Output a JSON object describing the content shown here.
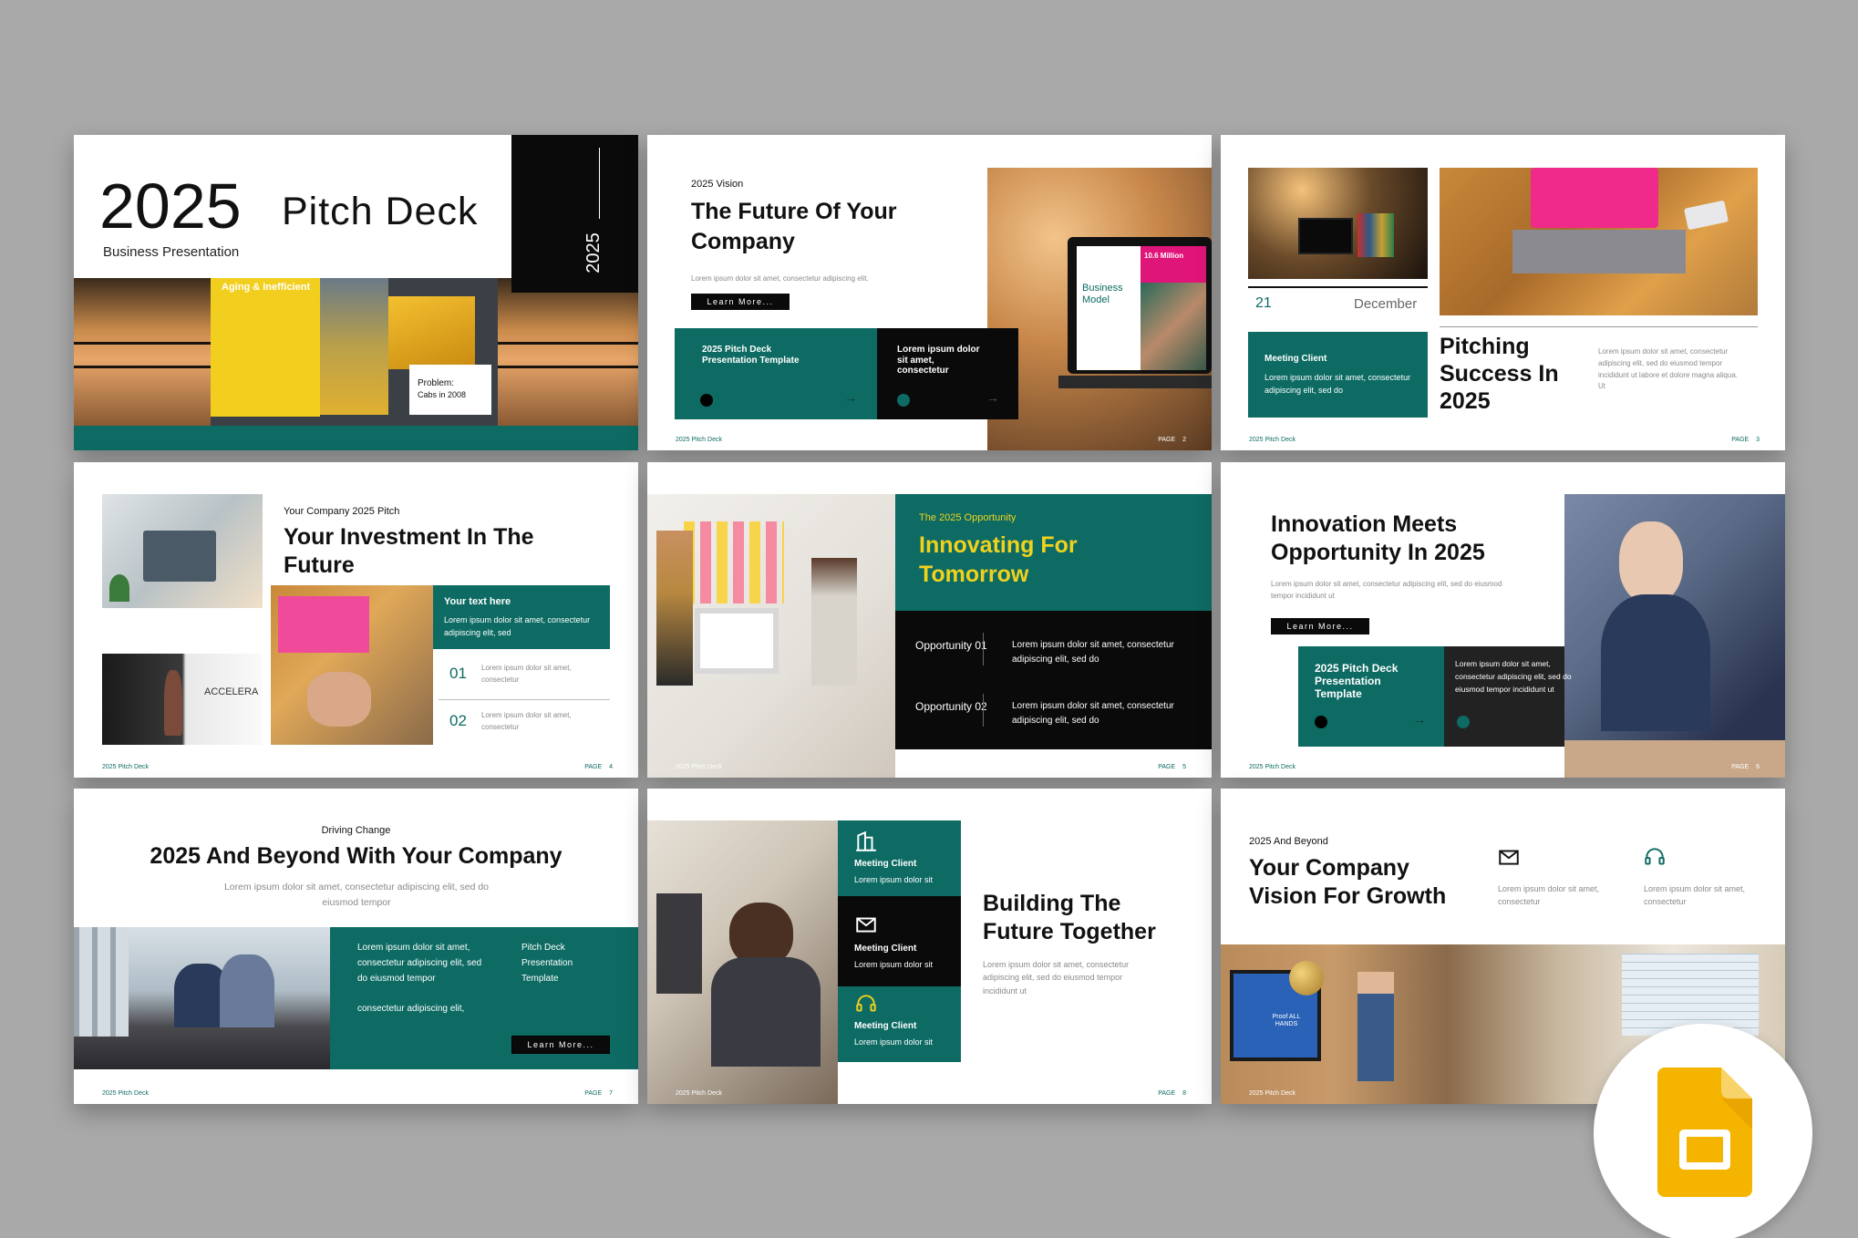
{
  "s1": {
    "year": "2025",
    "title": "Pitch Deck",
    "subtitle": "Business Presentation",
    "vertical": "2025",
    "card1": "Aging & Inefficient",
    "card2": "Problem:",
    "card3": "Cabs in 2008"
  },
  "s2": {
    "kicker": "2025 Vision",
    "title_line1": "The Future Of Your",
    "title_line2": "Company",
    "lorem": "Lorem ipsum dolor sit amet, consectetur adipiscing elit.",
    "button": "Learn More...",
    "teal_text": "2025 Pitch Deck Presentation Template",
    "black_text": "Lorem ipsum dolor sit amet, consectetur",
    "screen_label": "Business Model",
    "screen_stat": "10.6 Million",
    "footer": "2025 Pitch Deck",
    "page": "PAGE 2"
  },
  "s3": {
    "day": "21",
    "month": "December",
    "box_title": "Meeting Client",
    "box_text": "Lorem ipsum dolor sit amet, consectetur adipiscing elit, sed do",
    "title_line1": "Pitching",
    "title_line2": "Success In",
    "title_line3": "2025",
    "lorem": "Lorem ipsum dolor sit amet, consectetur adipiscing elit, sed do eiusmod tempor incididunt ut labore et dolore magna aliqua. Ut",
    "footer": "2025 Pitch Deck",
    "page": "PAGE 3"
  },
  "s4": {
    "kicker": "Your Company 2025 Pitch",
    "title_line1": "Your Investment In The",
    "title_line2": "Future",
    "box_title": "Your text here",
    "box_text": "Lorem ipsum dolor sit amet, consectetur adipiscing elit, sed",
    "item1_num": "01",
    "item1_text": "Lorem ipsum dolor sit amet, consectetur",
    "item2_num": "02",
    "item2_text": "Lorem ipsum dolor sit amet, consectetur",
    "sign": "ACCELERA",
    "footer": "2025 Pitch Deck",
    "page": "PAGE 4"
  },
  "s5": {
    "kicker": "The 2025 Opportunity",
    "title_line1": "Innovating For",
    "title_line2": "Tomorrow",
    "op1_label": "Opportunity 01",
    "op1_text": "Lorem ipsum dolor sit amet, consectetur adipiscing elit, sed do",
    "op2_label": "Opportunity 02",
    "op2_text": "Lorem ipsum dolor sit amet, consectetur adipiscing elit, sed do",
    "footer": "2025 Pitch Deck",
    "page": "PAGE 5"
  },
  "s6": {
    "title_line1": "Innovation Meets",
    "title_line2": "Opportunity In 2025",
    "lorem": "Lorem ipsum dolor sit amet, consectetur adipiscing elit, sed do eiusmod tempor incididunt ut",
    "button": "Learn More...",
    "teal_text": "2025 Pitch Deck Presentation Template",
    "dark_text": "Lorem ipsum dolor sit amet, consectetur adipiscing elit, sed do eiusmod tempor incididunt ut",
    "footer": "2025 Pitch Deck",
    "page": "PAGE 6"
  },
  "s7": {
    "kicker": "Driving Change",
    "title": "2025 And Beyond With Your Company",
    "lorem": "Lorem ipsum dolor sit amet, consectetur adipiscing elit, sed do eiusmod tempor",
    "teal_text1": "Lorem ipsum dolor sit amet, consectetur adipiscing elit, sed do eiusmod tempor",
    "teal_text2": "consectetur adipiscing elit,",
    "teal_side": "Pitch Deck Presentation Template",
    "button": "Learn More...",
    "footer": "2025 Pitch Deck",
    "page": "PAGE 7"
  },
  "s8": {
    "item1_title": "Meeting Client",
    "item1_text": "Lorem ipsum dolor sit",
    "item2_title": "Meeting Client",
    "item2_text": "Lorem ipsum dolor sit",
    "item3_title": "Meeting Client",
    "item3_text": "Lorem ipsum dolor sit",
    "title_line1": "Building The",
    "title_line2": "Future Together",
    "lorem": "Lorem ipsum dolor sit amet, consectetur adipiscing elit, sed do eiusmod tempor incididunt ut",
    "footer": "2025 Pitch Deck",
    "page": "PAGE 8"
  },
  "s9": {
    "kicker": "2025 And Beyond",
    "title_line1": "Your Company",
    "title_line2": "Vision For Growth",
    "col1_text": "Lorem ipsum dolor sit amet, consectetur",
    "col2_text": "Lorem ipsum dolor sit amet, consectetur",
    "screen_text": "Proof ALL HANDS",
    "footer": "2025 Pitch Deck"
  },
  "colors": {
    "teal": "#0d6b63",
    "black": "#0a0a0a",
    "yellow_accent": "#f0d21e",
    "slides_icon": "#f5b400"
  },
  "icons": [
    "mail-icon",
    "headset-icon",
    "building-icon",
    "arrow-right-icon",
    "google-slides-icon"
  ]
}
